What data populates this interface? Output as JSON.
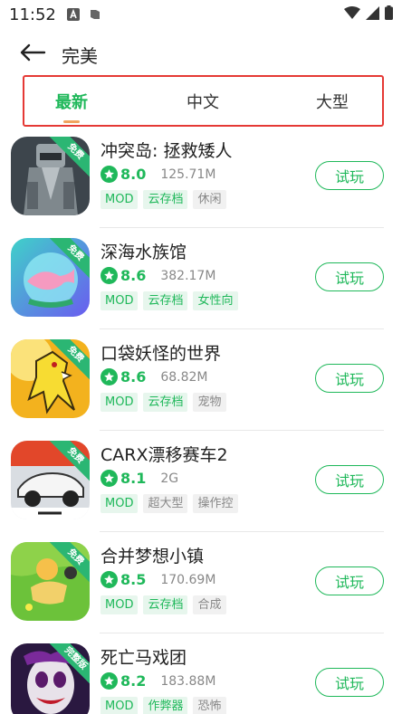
{
  "status_bar": {
    "time": "11:52"
  },
  "header": {
    "title": "完美"
  },
  "tabs": [
    {
      "label": "最新",
      "active": true
    },
    {
      "label": "中文",
      "active": false
    },
    {
      "label": "大型",
      "active": false
    }
  ],
  "apps": [
    {
      "name": "冲突岛: 拯救矮人",
      "rating": "8.0",
      "size": "125.71M",
      "ribbon": "免费",
      "tags": [
        {
          "text": "MOD",
          "kind": "mod"
        },
        {
          "text": "云存档",
          "kind": "green"
        },
        {
          "text": "休闲",
          "kind": "grey"
        }
      ],
      "button": "试玩"
    },
    {
      "name": "深海水族馆",
      "rating": "8.6",
      "size": "382.17M",
      "ribbon": "免费",
      "tags": [
        {
          "text": "MOD",
          "kind": "mod"
        },
        {
          "text": "云存档",
          "kind": "green"
        },
        {
          "text": "女性向",
          "kind": "green"
        }
      ],
      "button": "试玩"
    },
    {
      "name": "口袋妖怪的世界",
      "rating": "8.6",
      "size": "68.82M",
      "ribbon": "免费",
      "tags": [
        {
          "text": "MOD",
          "kind": "mod"
        },
        {
          "text": "云存档",
          "kind": "green"
        },
        {
          "text": "宠物",
          "kind": "grey"
        }
      ],
      "button": "试玩"
    },
    {
      "name": "CARX漂移赛车2",
      "rating": "8.1",
      "size": "2G",
      "ribbon": "免费",
      "tags": [
        {
          "text": "MOD",
          "kind": "mod"
        },
        {
          "text": "超大型",
          "kind": "grey"
        },
        {
          "text": "操作控",
          "kind": "grey"
        }
      ],
      "button": "试玩"
    },
    {
      "name": "合并梦想小镇",
      "rating": "8.5",
      "size": "170.69M",
      "ribbon": "免费",
      "tags": [
        {
          "text": "MOD",
          "kind": "mod"
        },
        {
          "text": "云存档",
          "kind": "green"
        },
        {
          "text": "合成",
          "kind": "grey"
        }
      ],
      "button": "试玩"
    },
    {
      "name": "死亡马戏团",
      "rating": "8.2",
      "size": "183.88M",
      "ribbon": "完整版",
      "tags": [
        {
          "text": "MOD",
          "kind": "mod"
        },
        {
          "text": "作弊器",
          "kind": "green"
        },
        {
          "text": "恐怖",
          "kind": "grey"
        }
      ],
      "button": "试玩"
    }
  ],
  "icon_art": [
    "dwarf-statue",
    "pink-whale-aquarium",
    "yellow-creature",
    "drift-racing-car",
    "girl-on-grass",
    "evil-clown"
  ],
  "colors": {
    "accent": "#1fb85a",
    "tab_outline": "#e53935",
    "indicator": "#f0a35e"
  }
}
